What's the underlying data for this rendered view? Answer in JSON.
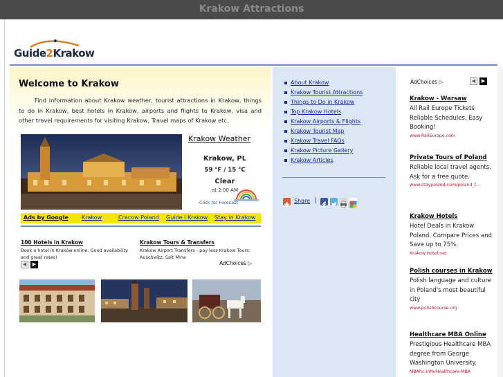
{
  "window": {
    "title": "Krakow Attractions"
  },
  "logo": {
    "text_a": "Guide",
    "text_b": "2",
    "text_c": "Krakow"
  },
  "welcome": {
    "title": "Welcome to Krakow",
    "body": "Find information about Krakow weather, tourist attractions in Krakow, things to do in Krakow, best hotels in Krakow, airports and flights to Krakow, visa and other travel requirements for visiting Krakow, Travel maps of Krakow etc."
  },
  "weather": {
    "title": "Krakow Weather",
    "city": "Krakow, PL",
    "temp": "59 °F / 15 °C",
    "condition": "Clear",
    "time": "at 2:00 AM",
    "link": "Click for Forecast"
  },
  "adbar": {
    "items": [
      "Ads by Google",
      "Krakow",
      "Cracow Poland",
      "Guide I Krakow",
      "Stay in Krakow"
    ]
  },
  "left_ads": [
    {
      "title": "100 Hotels in Krakow",
      "desc": "Book a hotel in Kraków online. Good availability and great rates!"
    },
    {
      "title": "Krakow Tours & Transfers",
      "desc": "Krakow Airport Transfers - pay less Krakow Tours: Auschwitz, Salt Mine"
    }
  ],
  "adchoices_label": "AdChoices",
  "nav_links": [
    "About Krakow",
    "Krakow Tourist Attractions",
    "Things to Do in Krakow",
    "Top Krakow Hotels",
    "Krakow Airports & Flights",
    "Krakow Tourist Map",
    "Krakow Travel FAQs",
    "Krakow Picture Gallery",
    "Krakow Articles"
  ],
  "share": {
    "label": "Share",
    "separator": "|"
  },
  "right_ads": [
    {
      "title": "Krakow - Warsaw",
      "desc": "All Rail Europe Tickets Reliable Schedules, Easy Booking!",
      "url": "www.RailEurope.com"
    },
    {
      "title": "Private Tours of Poland",
      "desc": "Reliable local travel agents. Ask for a free quote.",
      "url": "www.staypoland.com/poland_t..."
    },
    {
      "title": "Krakow Hotels",
      "desc": "Hotel Deals in Krakow Poland. Compare Prices and Save up to 75%.",
      "url": "Krakow.Hotel.net"
    },
    {
      "title": "Polish courses in Krakow",
      "desc": "Polish language and culture in Poland's most beautiful city",
      "url": "www.polishcourse.org"
    },
    {
      "title": "Healthcare MBA Online",
      "desc": "Prestigious Healthcare MBA degree from George Washington University.",
      "url": "MBAhc.info/Healthcare-MBA"
    }
  ],
  "colors": {
    "accent_blue": "#6d8fb7",
    "link_blue": "#1a2aa0",
    "ad_yellow": "#f2e600",
    "ad_url_red": "#c8102e"
  }
}
